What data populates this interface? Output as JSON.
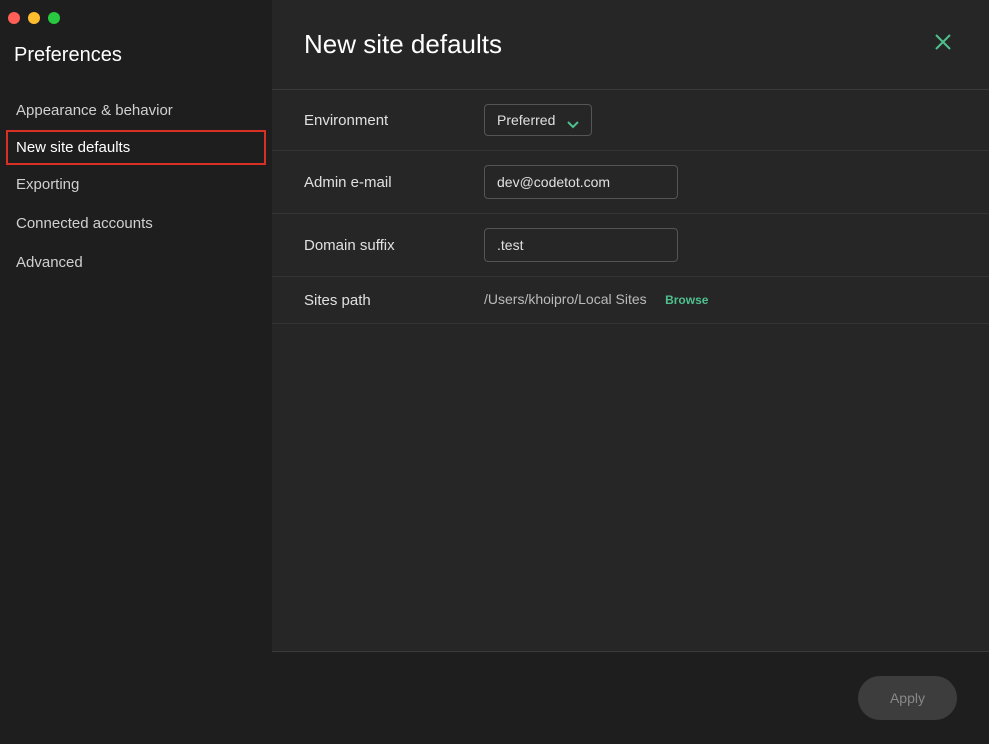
{
  "sidebar": {
    "title": "Preferences",
    "items": [
      {
        "label": "Appearance & behavior",
        "active": false
      },
      {
        "label": "New site defaults",
        "active": true
      },
      {
        "label": "Exporting",
        "active": false
      },
      {
        "label": "Connected accounts",
        "active": false
      },
      {
        "label": "Advanced",
        "active": false
      }
    ]
  },
  "main": {
    "title": "New site defaults",
    "form": {
      "environment": {
        "label": "Environment",
        "value": "Preferred"
      },
      "admin_email": {
        "label": "Admin e-mail",
        "value": "dev@codetot.com"
      },
      "domain_suffix": {
        "label": "Domain suffix",
        "value": ".test"
      },
      "sites_path": {
        "label": "Sites path",
        "value": "/Users/khoipro/Local Sites",
        "browse": "Browse"
      }
    },
    "footer": {
      "apply": "Apply"
    }
  }
}
